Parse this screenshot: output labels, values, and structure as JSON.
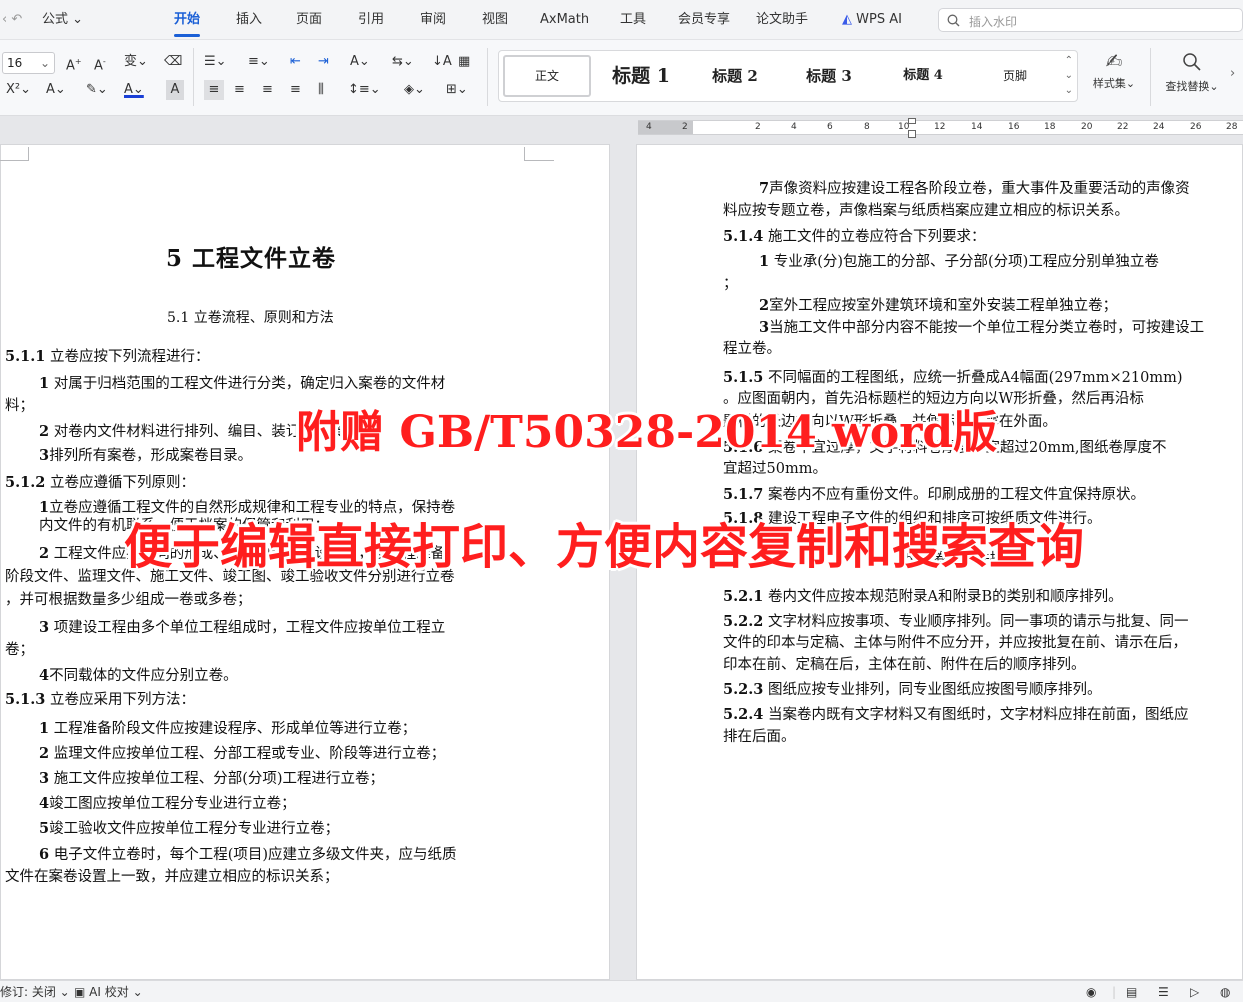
{
  "menubar": {
    "formula": "公式",
    "tabs": [
      "开始",
      "插入",
      "页面",
      "引用",
      "审阅",
      "视图",
      "AxMath",
      "工具",
      "会员专享",
      "论文助手",
      "WPS AI"
    ],
    "search_placeholder": "插入水印"
  },
  "toolbar": {
    "font_size": "16",
    "styles": {
      "normal": "正文",
      "h1": "标题 1",
      "h2": "标题 2",
      "h3": "标题 3",
      "h4": "标题 4",
      "footer": "页脚"
    },
    "style_set": "样式集",
    "find_replace": "查找替换"
  },
  "ruler": {
    "ticks": [
      "4",
      "2",
      "2",
      "4",
      "6",
      "8",
      "10",
      "12",
      "14",
      "16",
      "18",
      "20",
      "22",
      "24",
      "26",
      "28"
    ]
  },
  "left_page": {
    "chapter_title": "5  工程文件立卷",
    "section_title": "5.1 立卷流程、原则和方法",
    "lines": [
      [
        "5.1.1",
        "立卷应按下列流程进行："
      ],
      [
        "1",
        "对属于归档范围的工程文件进行分类，确定归入案卷的文件材"
      ],
      [
        "",
        "料；"
      ],
      [
        "2",
        "对卷内文件材料进行排列、编目、装订（或装盒）；"
      ],
      [
        "3",
        "排列所有案卷，形成案卷目录。"
      ],
      [
        "5.1.2",
        "立卷应遵循下列原则："
      ],
      [
        "1",
        "立卷应遵循工程文件的自然形成规律和工程专业的特点，保持卷"
      ],
      [
        "",
        "内文件的有机联系，便于档案的保管和利用；"
      ],
      [
        "2",
        "工程文件应按不同的形成、整理单位及建设程序，按工程准备"
      ],
      [
        "",
        "阶段文件、监理文件、施工文件、竣工图、竣工验收文件分别进行立卷"
      ],
      [
        "",
        "，并可根据数量多少组成一卷或多卷；"
      ],
      [
        "3",
        "项建设工程由多个单位工程组成时，工程文件应按单位工程立"
      ],
      [
        "",
        "卷；"
      ],
      [
        "4",
        "不同载体的文件应分别立卷。"
      ],
      [
        "5.1.3",
        "立卷应采用下列方法："
      ],
      [
        "1",
        "工程准备阶段文件应按建设程序、形成单位等进行立卷；"
      ],
      [
        "2",
        "监理文件应按单位工程、分部工程或专业、阶段等进行立卷；"
      ],
      [
        "3",
        "施工文件应按单位工程、分部(分项)工程进行立卷；"
      ],
      [
        "4",
        "竣工图应按单位工程分专业进行立卷；"
      ],
      [
        "5",
        "竣工验收文件应按单位工程分专业进行立卷；"
      ],
      [
        "6",
        "电子文件立卷时，每个工程(项目)应建立多级文件夹，应与纸质"
      ],
      [
        "",
        "文件在案卷设置上一致，并应建立相应的标识关系；"
      ]
    ]
  },
  "right_page": {
    "lines": [
      [
        "7",
        "声像资料应按建设工程各阶段立卷，重大事件及重要活动的声像资"
      ],
      [
        "",
        "料应按专题立卷，声像档案与纸质档案应建立相应的标识关系。"
      ],
      [
        "5.1.4",
        "施工文件的立卷应符合下列要求："
      ],
      [
        "1",
        "专业承(分)包施工的分部、子分部(分项)工程应分别单独立卷"
      ],
      [
        "",
        "；"
      ],
      [
        "2",
        "室外工程应按室外建筑环境和室外安装工程单独立卷；"
      ],
      [
        "3",
        "当施工文件中部分内容不能按一个单位工程分类立卷时，可按建设工"
      ],
      [
        "",
        "程立卷。"
      ],
      [
        "5.1.5",
        "不同幅面的工程图纸，应统一折叠成A4幅面(297mm×210mm)"
      ],
      [
        "",
        "。应图面朝内，首先沿标题栏的短边方向以W形折叠，然后再沿标"
      ],
      [
        "",
        "题栏的长边方向以W形折叠，并使标题栏露在外面。"
      ],
      [
        "5.1.6",
        "案卷不宜过厚，文字材料卷厚度不宜超过20mm,图纸卷厚度不"
      ],
      [
        "",
        "宜超过50mm。"
      ],
      [
        "5.1.7",
        "案卷内不应有重份文件。印刷成册的工程文件宜保持原状。"
      ],
      [
        "5.1.8",
        "建设工程电子文件的组织和排序可按纸质文件进行。"
      ],
      [
        "5.2",
        "卷内文件排列"
      ],
      [
        "5.2.1",
        "卷内文件应按本规范附录A和附录B的类别和顺序排列。"
      ],
      [
        "5.2.2",
        "文字材料应按事项、专业顺序排列。同一事项的请示与批复、同一"
      ],
      [
        "",
        "文件的印本与定稿、主体与附件不应分开，并应按批复在前、请示在后，"
      ],
      [
        "",
        "印本在前、定稿在后，主体在前、附件在后的顺序排列。"
      ],
      [
        "5.2.3",
        "图纸应按专业排列，同专业图纸应按图号顺序排列。"
      ],
      [
        "5.2.4",
        "当案卷内既有文字材料又有图纸时，文字材料应排在前面，图纸应"
      ],
      [
        "",
        "排在后面。"
      ]
    ]
  },
  "overlay": {
    "line1": "附赠 GB/T50328-2014 word版",
    "line2": "便于编辑直接打印、方便内容复制和搜索查询"
  },
  "statusbar": {
    "track": "修订: 关闭",
    "ai_check": "AI 校对"
  }
}
